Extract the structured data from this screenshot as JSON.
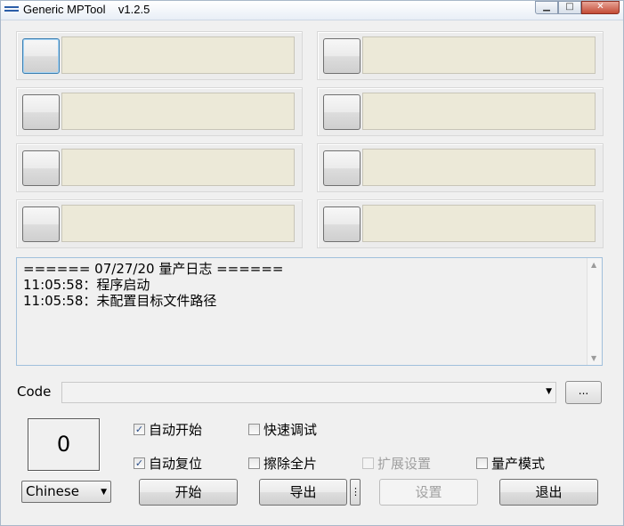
{
  "window": {
    "title": "Generic MPTool    v1.2.5",
    "min_icon": "minimize-icon",
    "max_icon": "maximize-icon",
    "close_icon": "close-icon"
  },
  "slots": [
    {
      "id": 1,
      "status": ""
    },
    {
      "id": 2,
      "status": ""
    },
    {
      "id": 3,
      "status": ""
    },
    {
      "id": 4,
      "status": ""
    },
    {
      "id": 5,
      "status": ""
    },
    {
      "id": 6,
      "status": ""
    },
    {
      "id": 7,
      "status": ""
    },
    {
      "id": 8,
      "status": ""
    }
  ],
  "log": {
    "lines": [
      "====== 07/27/20 量产日志 ======",
      "11:05:58：程序启动",
      "11:05:58：未配置目标文件路径"
    ]
  },
  "code": {
    "label": "Code",
    "value": "",
    "browse_label": "..."
  },
  "counter": {
    "value": "0"
  },
  "options": {
    "auto_start": {
      "label": "自动开始",
      "checked": true,
      "enabled": true
    },
    "fast_debug": {
      "label": "快速调试",
      "checked": false,
      "enabled": true
    },
    "auto_reset": {
      "label": "自动复位",
      "checked": true,
      "enabled": true
    },
    "erase_all": {
      "label": "擦除全片",
      "checked": false,
      "enabled": true
    },
    "ext_settings": {
      "label": "扩展设置",
      "checked": false,
      "enabled": false
    },
    "mp_mode": {
      "label": "量产模式",
      "checked": false,
      "enabled": true
    }
  },
  "language": {
    "selected": "Chinese"
  },
  "buttons": {
    "start": "开始",
    "export": "导出",
    "export_more": "⋮",
    "settings": "设置",
    "exit": "退出"
  },
  "colors": {
    "slot_field": "#ece9d8",
    "log_border": "#a0c0dc",
    "window_bg": "#f0f0f0"
  }
}
